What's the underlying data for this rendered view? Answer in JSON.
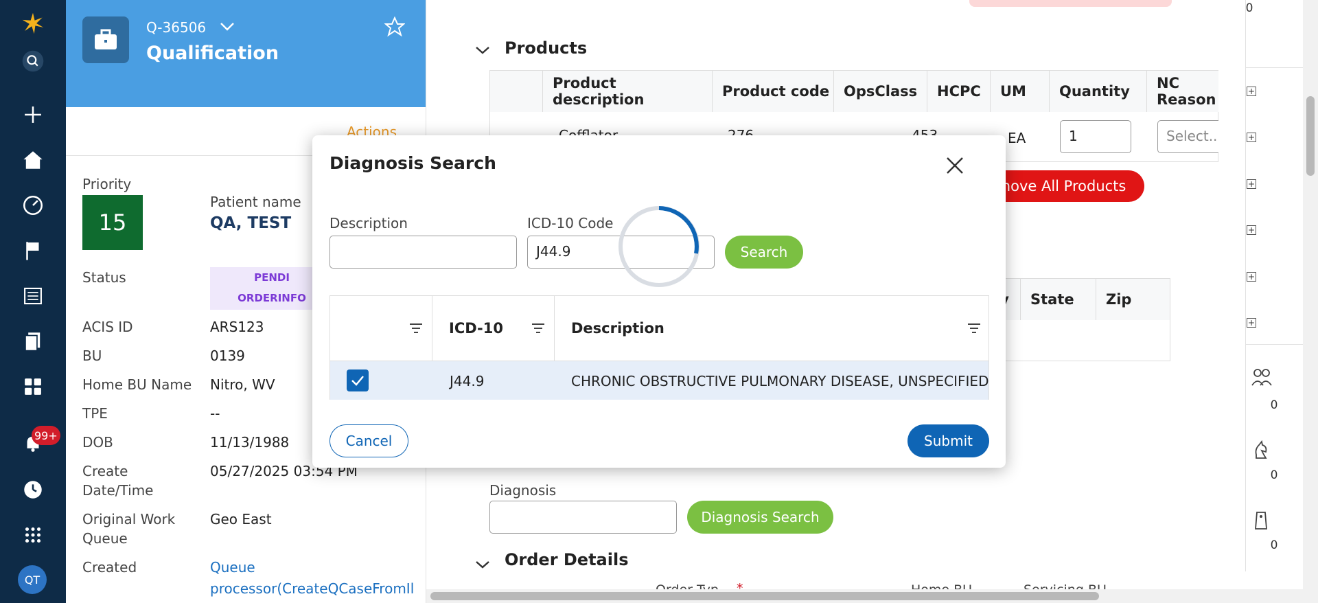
{
  "nav": {
    "logo": "sunburst-logo",
    "notifications_badge": "99+",
    "user_initials": "QT"
  },
  "case": {
    "id": "Q-36506",
    "title": "Qualification",
    "actions_label": "Actions",
    "fields": {
      "priority_label": "Priority",
      "priority_value": "15",
      "patient_label": "Patient name",
      "patient_value": "QA, TEST",
      "status_label": "Status",
      "status_value_line1": "PENDI",
      "status_value_line2": "ORDERINFO",
      "acis_label": "ACIS ID",
      "acis_value": "ARS123",
      "bu_label": "BU",
      "bu_value": "0139",
      "homebu_label": "Home BU Name",
      "homebu_value": "Nitro, WV",
      "tpe_label": "TPE",
      "tpe_value": "--",
      "dob_label": "DOB",
      "dob_value": "11/13/1988",
      "create_label_1": "Create",
      "create_label_2": "Date/Time",
      "create_value": "05/27/2025 03:54 PM",
      "owq_label_1": "Original Work",
      "owq_label_2": "Queue",
      "owq_value": "Geo East",
      "created_label": "Created",
      "created_value_1": "Queue",
      "created_value_2": "processor(CreateQCaseFromIl"
    }
  },
  "main": {
    "products_heading": "Products",
    "products_columns": [
      "Product description",
      "Product code",
      "OpsClass",
      "HCPC",
      "UM",
      "Quantity",
      "NC Reason"
    ],
    "products_row": {
      "description": "Cofflator",
      "code": "276",
      "opsclass": "453",
      "um": "EA",
      "quantity": "1",
      "nc_placeholder": "Select..."
    },
    "remove_all_label": "move All Products",
    "address_columns": [
      "City",
      "State",
      "Zip"
    ],
    "diagnosis_label": "Diagnosis",
    "diagnosis_value": "",
    "diagnosis_search_label": "Diagnosis Search",
    "order_details_heading": "Order Details",
    "order_details_sub": [
      "Order Typ",
      "Home BU",
      "Servicing BU"
    ]
  },
  "rail": {
    "counts": [
      "0",
      "0",
      "0",
      "0"
    ]
  },
  "modal": {
    "title": "Diagnosis Search",
    "description_label": "Description",
    "description_value": "",
    "icd_label": "ICD-10 Code",
    "icd_value": "J44.9",
    "search_label": "Search",
    "columns": [
      "ICD-10",
      "Description"
    ],
    "rows": [
      {
        "checked": true,
        "code": "J44.9",
        "description": "CHRONIC OBSTRUCTIVE PULMONARY DISEASE, UNSPECIFIED"
      }
    ],
    "cancel_label": "Cancel",
    "submit_label": "Submit"
  },
  "colors": {
    "nav_bg": "#0e2b47",
    "case_header": "#4a9ee2",
    "priority_green": "#0f6b2f",
    "accent_blue": "#0f65b5",
    "search_green": "#7bc042",
    "remove_red": "#e01515"
  }
}
